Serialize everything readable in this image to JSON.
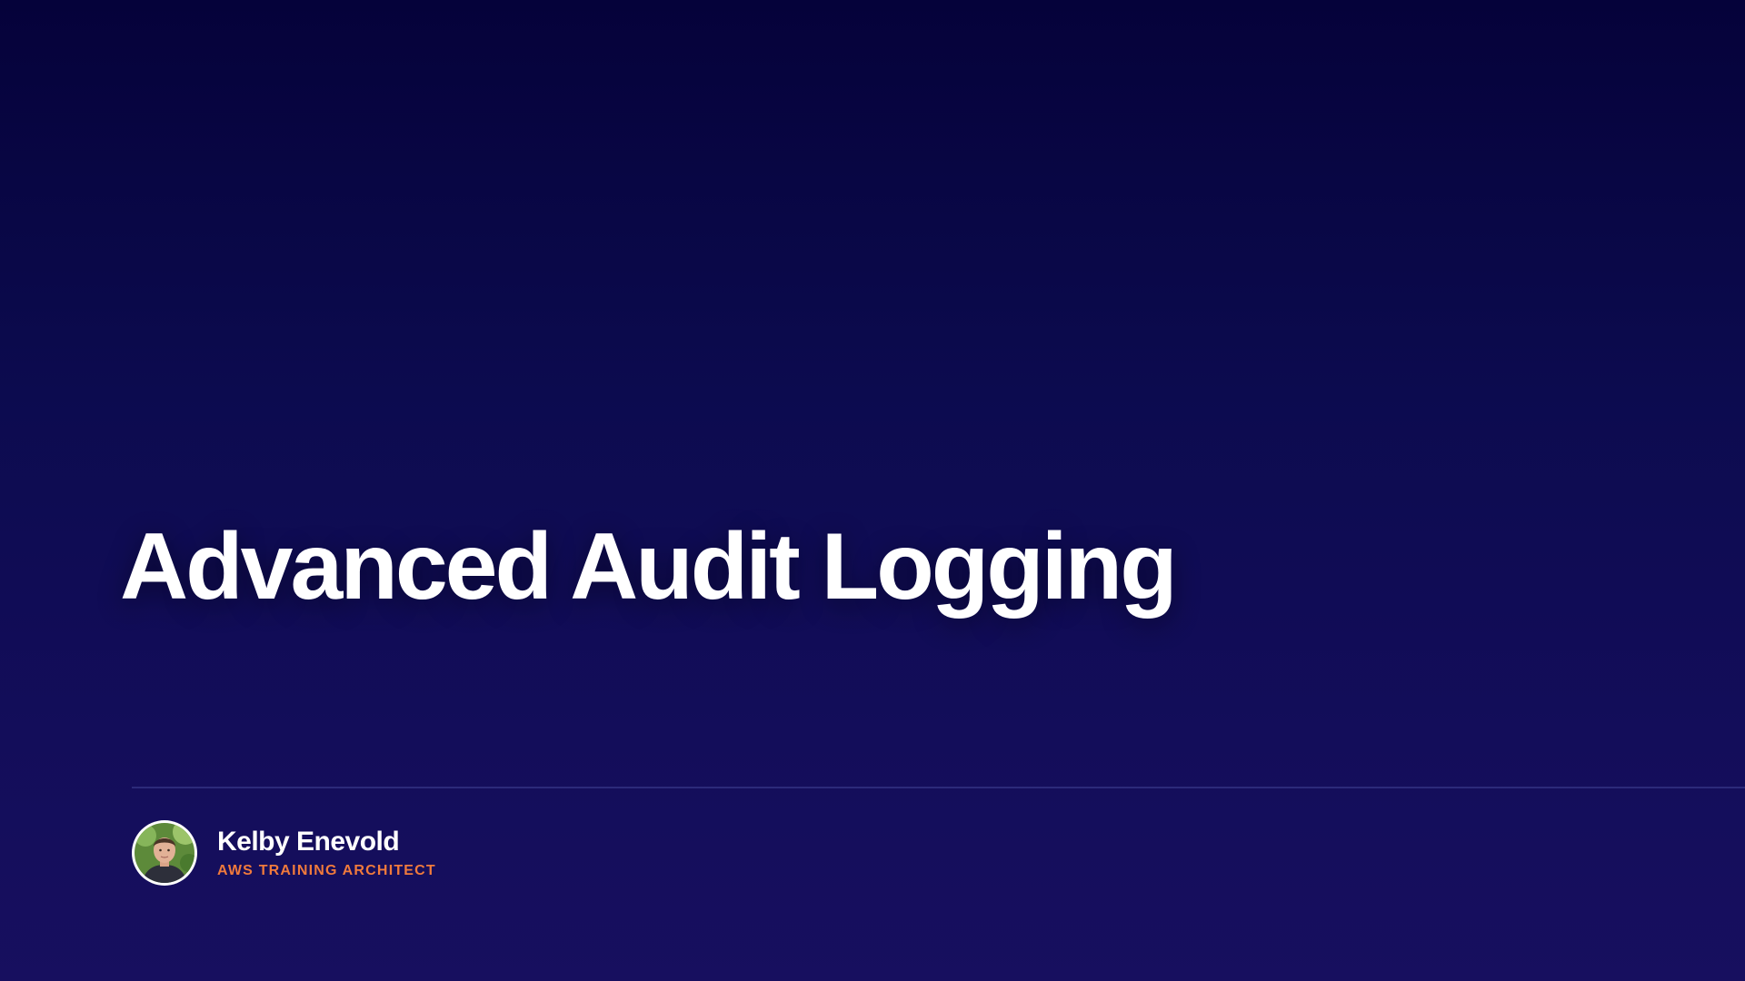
{
  "slide": {
    "title": "Advanced Audit Logging"
  },
  "presenter": {
    "name": "Kelby Enevold",
    "role": "AWS TRAINING ARCHITECT",
    "avatar": "presenter-photo"
  },
  "colors": {
    "background_top": "#05023a",
    "background_bottom": "#170f5f",
    "title": "#ffffff",
    "accent": "#f07a3c",
    "divider": "#2c2a7a"
  }
}
